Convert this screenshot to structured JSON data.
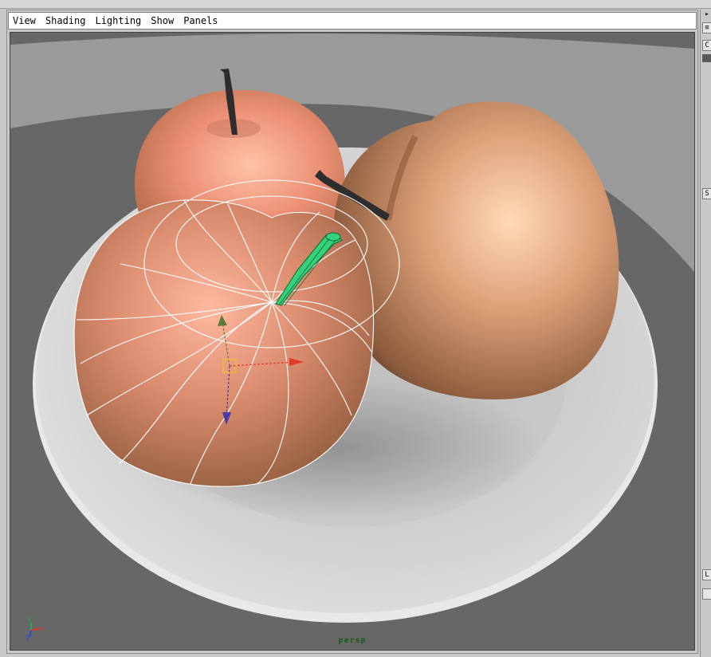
{
  "menu": {
    "items": [
      "View",
      "Shading",
      "Lighting",
      "Show",
      "Panels"
    ]
  },
  "viewport": {
    "camera_label": "persp",
    "axis_labels": {
      "x": "x",
      "y": "y",
      "z": "z"
    }
  },
  "right_panel": {
    "arrow_glyph": "▸",
    "menu_glyph": "≡",
    "btn_a": "C",
    "btn_b": "S",
    "btn_c": "L"
  },
  "colors": {
    "viewport_bg": "#666666",
    "ground_light": "#9c9c9c",
    "plate": "#d8d8d8",
    "apple_skin": "#dc9a78",
    "selected_wire": "#ffffff",
    "stem_selected": "#34d07a"
  }
}
